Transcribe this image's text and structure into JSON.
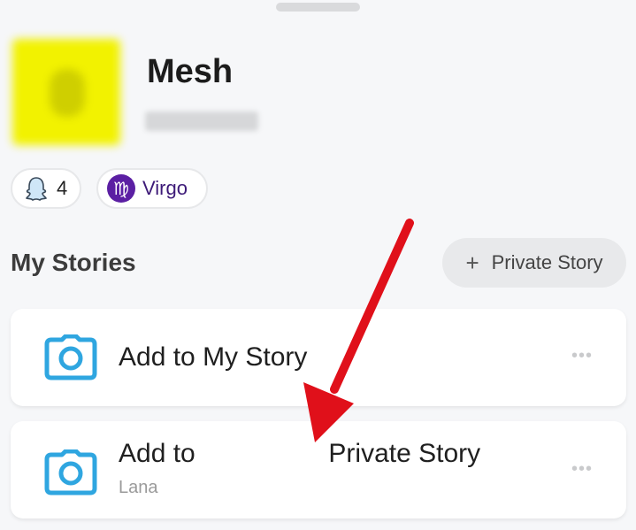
{
  "profile": {
    "display_name": "Mesh",
    "friends_count": "4",
    "zodiac_sign": "Virgo",
    "zodiac_symbol": "♍"
  },
  "stories": {
    "section_title": "My Stories",
    "private_story_button": "Private Story",
    "private_story_plus": "+",
    "items": [
      {
        "title": "Add to My Story",
        "subtitle": "",
        "more": "•••"
      },
      {
        "title_prefix": "Add to",
        "title_suffix": "Private Story",
        "subtitle": "Lana",
        "more": "•••"
      }
    ]
  },
  "colors": {
    "accent_blue": "#2fa6e0",
    "arrow_red": "#e0101a",
    "zodiac_purple": "#5b1fa3",
    "avatar_yellow": "#f2f200"
  },
  "icons": {
    "friends": "ghost-icon",
    "zodiac": "virgo-icon",
    "story": "camera-icon",
    "more": "more-dots-icon"
  }
}
